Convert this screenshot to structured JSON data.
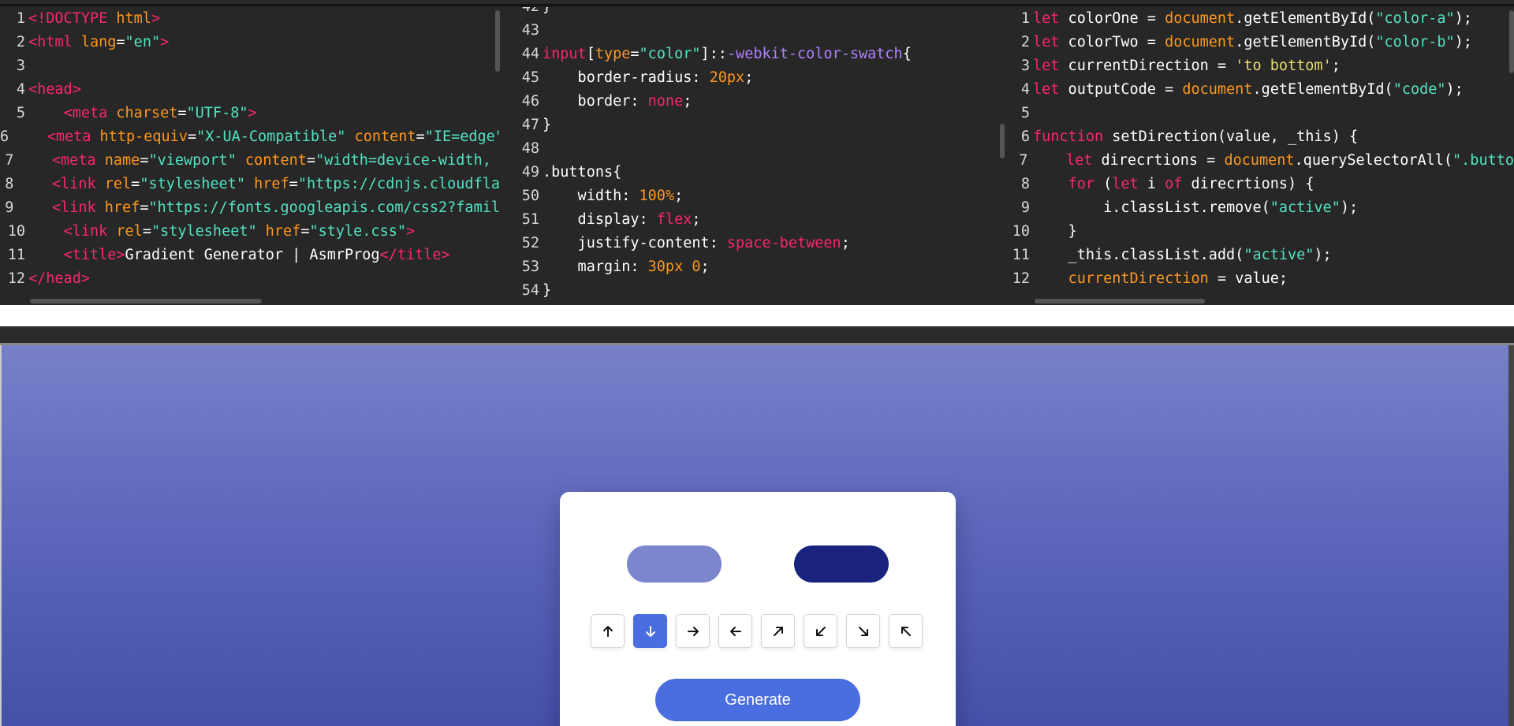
{
  "html_editor": {
    "lines": [
      {
        "n": "1",
        "parts": [
          [
            "t-tag",
            "<!DOCTYPE"
          ],
          [
            "t-var",
            " "
          ],
          [
            "t-doc",
            "html"
          ],
          [
            "t-tag",
            ">"
          ]
        ]
      },
      {
        "n": "2",
        "parts": [
          [
            "t-tag",
            "<html"
          ],
          [
            "t-var",
            " "
          ],
          [
            "t-attr",
            "lang"
          ],
          [
            "t-var",
            "="
          ],
          [
            "t-str",
            "\"en\""
          ],
          [
            "t-tag",
            ">"
          ]
        ]
      },
      {
        "n": "3",
        "parts": []
      },
      {
        "n": "4",
        "parts": [
          [
            "t-tag",
            "<head>"
          ]
        ]
      },
      {
        "n": "5",
        "parts": [
          [
            "t-var",
            "    "
          ],
          [
            "t-tag",
            "<meta"
          ],
          [
            "t-var",
            " "
          ],
          [
            "t-attr",
            "charset"
          ],
          [
            "t-var",
            "="
          ],
          [
            "t-str",
            "\"UTF-8\""
          ],
          [
            "t-tag",
            ">"
          ]
        ]
      },
      {
        "n": "6",
        "parts": [
          [
            "t-var",
            "    "
          ],
          [
            "t-tag",
            "<meta"
          ],
          [
            "t-var",
            " "
          ],
          [
            "t-attr",
            "http-equiv"
          ],
          [
            "t-var",
            "="
          ],
          [
            "t-str",
            "\"X-UA-Compatible\""
          ],
          [
            "t-var",
            " "
          ],
          [
            "t-attr",
            "content"
          ],
          [
            "t-var",
            "="
          ],
          [
            "t-str",
            "\"IE=edge\""
          ]
        ]
      },
      {
        "n": "7",
        "parts": [
          [
            "t-var",
            "    "
          ],
          [
            "t-tag",
            "<meta"
          ],
          [
            "t-var",
            " "
          ],
          [
            "t-attr",
            "name"
          ],
          [
            "t-var",
            "="
          ],
          [
            "t-str",
            "\"viewport\""
          ],
          [
            "t-var",
            " "
          ],
          [
            "t-attr",
            "content"
          ],
          [
            "t-var",
            "="
          ],
          [
            "t-str",
            "\"width=device-width, "
          ]
        ]
      },
      {
        "n": "8",
        "parts": [
          [
            "t-var",
            "    "
          ],
          [
            "t-tag",
            "<link"
          ],
          [
            "t-var",
            " "
          ],
          [
            "t-attr",
            "rel"
          ],
          [
            "t-var",
            "="
          ],
          [
            "t-str",
            "\"stylesheet\""
          ],
          [
            "t-var",
            " "
          ],
          [
            "t-attr",
            "href"
          ],
          [
            "t-var",
            "="
          ],
          [
            "t-str",
            "\"https://cdnjs.cloudfla"
          ]
        ]
      },
      {
        "n": "9",
        "parts": [
          [
            "t-var",
            "    "
          ],
          [
            "t-tag",
            "<link"
          ],
          [
            "t-var",
            " "
          ],
          [
            "t-attr",
            "href"
          ],
          [
            "t-var",
            "="
          ],
          [
            "t-str",
            "\"https://fonts.googleapis.com/css2?famil"
          ]
        ]
      },
      {
        "n": "10",
        "parts": [
          [
            "t-var",
            "    "
          ],
          [
            "t-tag",
            "<link"
          ],
          [
            "t-var",
            " "
          ],
          [
            "t-attr",
            "rel"
          ],
          [
            "t-var",
            "="
          ],
          [
            "t-str",
            "\"stylesheet\""
          ],
          [
            "t-var",
            " "
          ],
          [
            "t-attr",
            "href"
          ],
          [
            "t-var",
            "="
          ],
          [
            "t-str",
            "\"style.css\""
          ],
          [
            "t-tag",
            ">"
          ]
        ]
      },
      {
        "n": "11",
        "parts": [
          [
            "t-var",
            "    "
          ],
          [
            "t-tag",
            "<title>"
          ],
          [
            "t-var",
            "Gradient Generator | AsmrProg"
          ],
          [
            "t-tag",
            "</title>"
          ]
        ]
      },
      {
        "n": "12",
        "parts": [
          [
            "t-tag",
            "</head>"
          ]
        ]
      }
    ]
  },
  "css_editor": {
    "lines": [
      {
        "n": "42",
        "parts": [
          [
            "t-var",
            "}"
          ]
        ]
      },
      {
        "n": "43",
        "parts": []
      },
      {
        "n": "44",
        "parts": [
          [
            "t-tag",
            "input"
          ],
          [
            "t-var",
            "["
          ],
          [
            "t-attr",
            "type"
          ],
          [
            "t-var",
            "="
          ],
          [
            "t-str",
            "\"color\""
          ],
          [
            "t-var",
            "]::"
          ],
          [
            "t-pseudo",
            "-webkit-color-swatch"
          ],
          [
            "t-var",
            "{"
          ]
        ]
      },
      {
        "n": "45",
        "parts": [
          [
            "t-var",
            "    border-radius: "
          ],
          [
            "t-num",
            "20px"
          ],
          [
            "t-var",
            ";"
          ]
        ]
      },
      {
        "n": "46",
        "parts": [
          [
            "t-var",
            "    border: "
          ],
          [
            "t-val",
            "none"
          ],
          [
            "t-var",
            ";"
          ]
        ]
      },
      {
        "n": "47",
        "parts": [
          [
            "t-var",
            "}"
          ]
        ]
      },
      {
        "n": "48",
        "parts": []
      },
      {
        "n": "49",
        "parts": [
          [
            "t-var",
            ".buttons{"
          ]
        ]
      },
      {
        "n": "50",
        "parts": [
          [
            "t-var",
            "    width: "
          ],
          [
            "t-num",
            "100%"
          ],
          [
            "t-var",
            ";"
          ]
        ]
      },
      {
        "n": "51",
        "parts": [
          [
            "t-var",
            "    display: "
          ],
          [
            "t-val",
            "flex"
          ],
          [
            "t-var",
            ";"
          ]
        ]
      },
      {
        "n": "52",
        "parts": [
          [
            "t-var",
            "    justify-content: "
          ],
          [
            "t-val",
            "space-between"
          ],
          [
            "t-var",
            ";"
          ]
        ]
      },
      {
        "n": "53",
        "parts": [
          [
            "t-var",
            "    margin: "
          ],
          [
            "t-num",
            "30px 0"
          ],
          [
            "t-var",
            ";"
          ]
        ]
      },
      {
        "n": "54",
        "parts": [
          [
            "t-var",
            "}"
          ]
        ]
      }
    ]
  },
  "js_editor": {
    "lines": [
      {
        "n": "1",
        "parts": [
          [
            "t-kw",
            "let"
          ],
          [
            "t-var",
            " colorOne = "
          ],
          [
            "t-attr",
            "document"
          ],
          [
            "t-var",
            ".getElementById("
          ],
          [
            "t-str",
            "\"color-a\""
          ],
          [
            "t-var",
            ");"
          ]
        ]
      },
      {
        "n": "2",
        "parts": [
          [
            "t-kw",
            "let"
          ],
          [
            "t-var",
            " colorTwo = "
          ],
          [
            "t-attr",
            "document"
          ],
          [
            "t-var",
            ".getElementById("
          ],
          [
            "t-str",
            "\"color-b\""
          ],
          [
            "t-var",
            ");"
          ]
        ]
      },
      {
        "n": "3",
        "parts": [
          [
            "t-kw",
            "let"
          ],
          [
            "t-var",
            " currentDirection = "
          ],
          [
            "t-js-str2",
            "'to bottom'"
          ],
          [
            "t-var",
            ";"
          ]
        ]
      },
      {
        "n": "4",
        "parts": [
          [
            "t-kw",
            "let"
          ],
          [
            "t-var",
            " outputCode = "
          ],
          [
            "t-attr",
            "document"
          ],
          [
            "t-var",
            ".getElementById("
          ],
          [
            "t-str",
            "\"code\""
          ],
          [
            "t-var",
            ");"
          ]
        ]
      },
      {
        "n": "5",
        "parts": []
      },
      {
        "n": "6",
        "parts": [
          [
            "t-kw",
            "function"
          ],
          [
            "t-var",
            " setDirection(value, _this) {"
          ]
        ]
      },
      {
        "n": "7",
        "parts": [
          [
            "t-var",
            "    "
          ],
          [
            "t-kw",
            "let"
          ],
          [
            "t-var",
            " direcrtions = "
          ],
          [
            "t-attr",
            "document"
          ],
          [
            "t-var",
            ".querySelectorAll("
          ],
          [
            "t-str",
            "\".butto"
          ]
        ]
      },
      {
        "n": "8",
        "parts": [
          [
            "t-var",
            "    "
          ],
          [
            "t-kw",
            "for"
          ],
          [
            "t-var",
            " ("
          ],
          [
            "t-kw",
            "let"
          ],
          [
            "t-var",
            " i "
          ],
          [
            "t-kw",
            "of"
          ],
          [
            "t-var",
            " direcrtions) {"
          ]
        ]
      },
      {
        "n": "9",
        "parts": [
          [
            "t-var",
            "        i.classList.remove("
          ],
          [
            "t-str",
            "\"active\""
          ],
          [
            "t-var",
            ");"
          ]
        ]
      },
      {
        "n": "10",
        "parts": [
          [
            "t-var",
            "    }"
          ]
        ]
      },
      {
        "n": "11",
        "parts": [
          [
            "t-var",
            "    _this.classList.add("
          ],
          [
            "t-str",
            "\"active\""
          ],
          [
            "t-var",
            ");"
          ]
        ]
      },
      {
        "n": "12",
        "parts": [
          [
            "t-var",
            "    "
          ],
          [
            "t-attr",
            "currentDirection"
          ],
          [
            "t-var",
            " = value;"
          ]
        ]
      }
    ]
  },
  "preview": {
    "color_a": "#7b86cf",
    "color_b": "#1a237e",
    "direction_buttons": [
      {
        "icon": "arrow-up-icon",
        "active": false
      },
      {
        "icon": "arrow-down-icon",
        "active": true
      },
      {
        "icon": "arrow-right-icon",
        "active": false
      },
      {
        "icon": "arrow-left-icon",
        "active": false
      },
      {
        "icon": "arrow-up-right-icon",
        "active": false
      },
      {
        "icon": "arrow-down-left-icon",
        "active": false
      },
      {
        "icon": "arrow-down-right-icon",
        "active": false
      },
      {
        "icon": "arrow-up-left-icon",
        "active": false
      }
    ],
    "generate_label": "Generate"
  }
}
